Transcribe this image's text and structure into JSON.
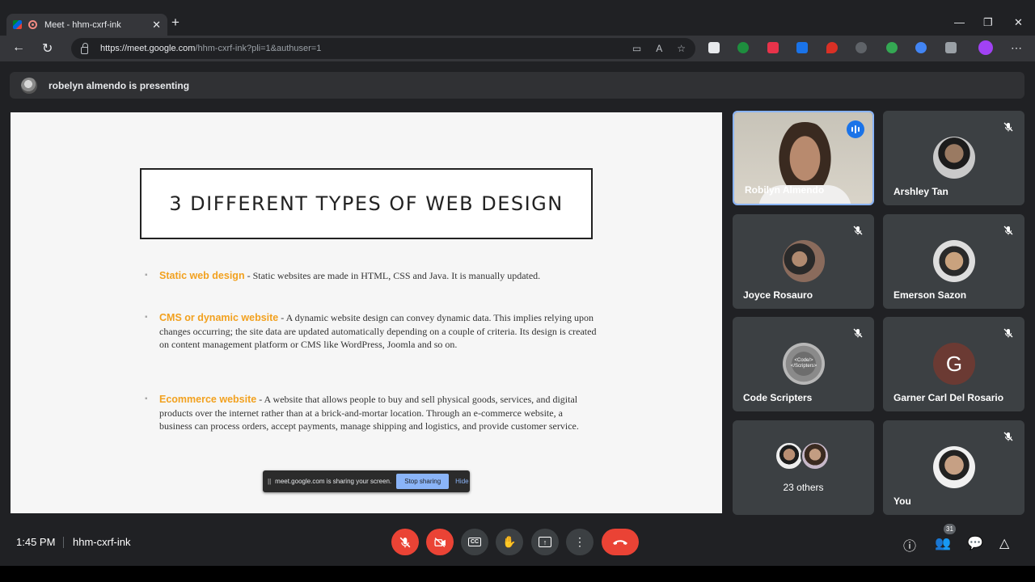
{
  "browser": {
    "tab_title": "Meet - hhm-cxrf-ink",
    "new_tab": "+",
    "url_host": "https://meet.google.com",
    "url_path": "/hhm-cxrf-ink?pli=1&authuser=1",
    "window_controls": {
      "minimize": "—",
      "restore": "❐",
      "close": "✕"
    }
  },
  "presenting": {
    "text": "robelyn almendo is presenting"
  },
  "slide": {
    "title": "3 DIFFERENT TYPES OF WEB DESIGN",
    "bullets": [
      {
        "head": "Static web design",
        "text": " - Static websites are made in HTML, CSS and Java. It is manually updated."
      },
      {
        "head": "CMS or dynamic website",
        "text": " - A dynamic website design can convey dynamic data. This implies relying upon changes occurring; the site data are updated automatically depending on a couple of criteria. Its design is created on content management platform or CMS like WordPress, Joomla and so on."
      },
      {
        "head": "Ecommerce website",
        "text": " - A website that allows people to buy and sell physical goods, services, and digital products over the internet rather than at a brick-and-mortar location. Through an e-commerce website, a business can process orders, accept payments, manage shipping and logistics, and provide customer service."
      }
    ]
  },
  "share_popup": {
    "message": "meet.google.com is sharing your screen.",
    "stop": "Stop sharing",
    "hide": "Hide"
  },
  "participants": [
    {
      "name": "Robilyn Almendo"
    },
    {
      "name": "Arshley Tan"
    },
    {
      "name": "Joyce Rosauro"
    },
    {
      "name": "Emerson Sazon"
    },
    {
      "name": "Code Scripters",
      "avatar_text": "<Code/> </Scripters>"
    },
    {
      "name": "Garner Carl Del Rosario",
      "initial": "G"
    },
    {
      "label": "23 others"
    },
    {
      "name": "You"
    }
  ],
  "bottom": {
    "time": "1:45 PM",
    "meeting_code": "hhm-cxrf-ink",
    "people_count": "31"
  },
  "colors": {
    "accent": "#f2a11f",
    "danger": "#ea4335",
    "blue": "#8ab4f8"
  }
}
